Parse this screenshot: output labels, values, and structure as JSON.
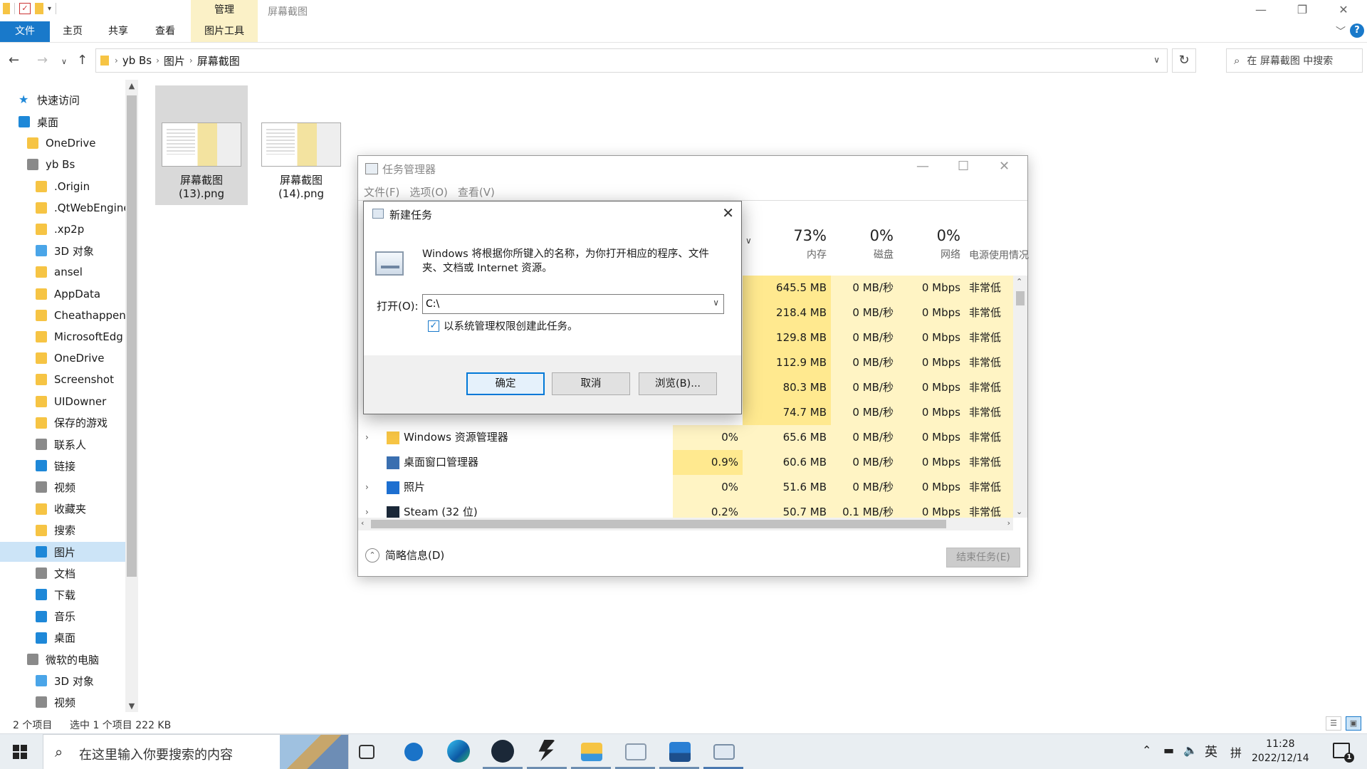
{
  "explorer": {
    "window_title": "屏幕截图",
    "contextual_group": "管理",
    "ribbon_tabs": [
      "文件",
      "主页",
      "共享",
      "查看",
      "图片工具"
    ],
    "help": "?",
    "breadcrumb": [
      "yb Bs",
      "图片",
      "屏幕截图"
    ],
    "search_placeholder": "在 屏幕截图 中搜索",
    "nav_items": [
      {
        "label": "快速访问",
        "icon": "star-icon"
      },
      {
        "label": "桌面",
        "icon": "desktop-icon"
      },
      {
        "label": "OneDrive",
        "icon": "folder-icon"
      },
      {
        "label": "yb Bs",
        "icon": "user-icon"
      },
      {
        "label": ".Origin",
        "icon": "folder-icon"
      },
      {
        "label": ".QtWebEngine",
        "icon": "folder-icon"
      },
      {
        "label": ".xp2p",
        "icon": "folder-icon"
      },
      {
        "label": "3D 对象",
        "icon": "cube-icon"
      },
      {
        "label": "ansel",
        "icon": "folder-icon"
      },
      {
        "label": "AppData",
        "icon": "folder-icon"
      },
      {
        "label": "Cheathappens",
        "icon": "folder-icon"
      },
      {
        "label": "MicrosoftEdg",
        "icon": "folder-icon"
      },
      {
        "label": "OneDrive",
        "icon": "folder-icon"
      },
      {
        "label": "Screenshot",
        "icon": "folder-icon"
      },
      {
        "label": "UIDowner",
        "icon": "folder-icon"
      },
      {
        "label": "保存的游戏",
        "icon": "games-folder-icon"
      },
      {
        "label": "联系人",
        "icon": "contacts-icon"
      },
      {
        "label": "链接",
        "icon": "links-icon"
      },
      {
        "label": "视频",
        "icon": "video-icon"
      },
      {
        "label": "收藏夹",
        "icon": "favorites-icon"
      },
      {
        "label": "搜索",
        "icon": "search-folder-icon"
      },
      {
        "label": "图片",
        "icon": "pictures-icon"
      },
      {
        "label": "文档",
        "icon": "documents-icon"
      },
      {
        "label": "下载",
        "icon": "downloads-icon"
      },
      {
        "label": "音乐",
        "icon": "music-icon"
      },
      {
        "label": "桌面",
        "icon": "desktop-icon"
      },
      {
        "label": "微软的电脑",
        "icon": "computer-icon"
      },
      {
        "label": "3D 对象",
        "icon": "cube-icon"
      },
      {
        "label": "视频",
        "icon": "video-icon"
      }
    ],
    "selected_nav": "图片",
    "files": [
      {
        "name_line1": "屏幕截图",
        "name_line2": "(13).png",
        "selected": true
      },
      {
        "name_line1": "屏幕截图",
        "name_line2": "(14).png",
        "selected": false
      }
    ],
    "status_count": "2 个项目",
    "status_selected": "选中 1 个项目  222 KB"
  },
  "task_manager": {
    "title": "任务管理器",
    "menu": [
      "文件(F)",
      "选项(O)",
      "查看(V)"
    ],
    "columns": [
      {
        "pct": "73%",
        "label": "内存"
      },
      {
        "pct": "0%",
        "label": "磁盘"
      },
      {
        "pct": "0%",
        "label": "网络"
      },
      {
        "pct": "",
        "label": "电源使用情况"
      }
    ],
    "rows": [
      {
        "name": "",
        "cpu": "",
        "mem": "645.5 MB",
        "disk": "0 MB/秒",
        "net": "0 Mbps",
        "power": "非常低",
        "expand": false
      },
      {
        "name": "",
        "cpu": "",
        "mem": "218.4 MB",
        "disk": "0 MB/秒",
        "net": "0 Mbps",
        "power": "非常低",
        "expand": false
      },
      {
        "name": "",
        "cpu": "",
        "mem": "129.8 MB",
        "disk": "0 MB/秒",
        "net": "0 Mbps",
        "power": "非常低",
        "expand": false
      },
      {
        "name": "",
        "cpu": "",
        "mem": "112.9 MB",
        "disk": "0 MB/秒",
        "net": "0 Mbps",
        "power": "非常低",
        "expand": false
      },
      {
        "name": "",
        "cpu": "",
        "mem": "80.3 MB",
        "disk": "0 MB/秒",
        "net": "0 Mbps",
        "power": "非常低",
        "expand": false
      },
      {
        "name": "",
        "cpu": "",
        "mem": "74.7 MB",
        "disk": "0 MB/秒",
        "net": "0 Mbps",
        "power": "非常低",
        "expand": false
      },
      {
        "name": "Windows 资源管理器",
        "cpu": "0%",
        "mem": "65.6 MB",
        "disk": "0 MB/秒",
        "net": "0 Mbps",
        "power": "非常低",
        "expand": true
      },
      {
        "name": "桌面窗口管理器",
        "cpu": "0.9%",
        "mem": "60.6 MB",
        "disk": "0 MB/秒",
        "net": "0 Mbps",
        "power": "非常低",
        "expand": false
      },
      {
        "name": "照片",
        "cpu": "0%",
        "mem": "51.6 MB",
        "disk": "0 MB/秒",
        "net": "0 Mbps",
        "power": "非常低",
        "expand": true
      },
      {
        "name": "Steam (32 位)",
        "cpu": "0.2%",
        "mem": "50.7 MB",
        "disk": "0.1 MB/秒",
        "net": "0 Mbps",
        "power": "非常低",
        "expand": true
      }
    ],
    "fewer_details": "简略信息(D)",
    "end_task": "结束任务(E)"
  },
  "run_dialog": {
    "title": "新建任务",
    "description": "Windows 将根据你所键入的名称，为你打开相应的程序、文件夹、文档或 Internet 资源。",
    "open_label": "打开(O):",
    "open_value": "C:\\",
    "admin_checkbox": "以系统管理权限创建此任务。",
    "admin_checked": true,
    "ok": "确定",
    "cancel": "取消",
    "browse": "浏览(B)..."
  },
  "taskbar": {
    "search_placeholder": "在这里输入你要搜索的内容",
    "ime_lang": "英",
    "ime_mode": "拼",
    "time": "11:28",
    "date": "2022/12/14",
    "notification_count": "1",
    "apps": [
      "task-view-icon",
      "swift-icon",
      "edge-icon",
      "steam-icon",
      "app-icon",
      "file-explorer-icon",
      "task-manager-icon",
      "photos-icon",
      "run-dialog-icon"
    ]
  },
  "colors": {
    "accent": "#1979ca",
    "heat_light": "#fff4c4",
    "heat_mid": "#ffe98f",
    "contextual_tab": "#fbf1c7"
  }
}
